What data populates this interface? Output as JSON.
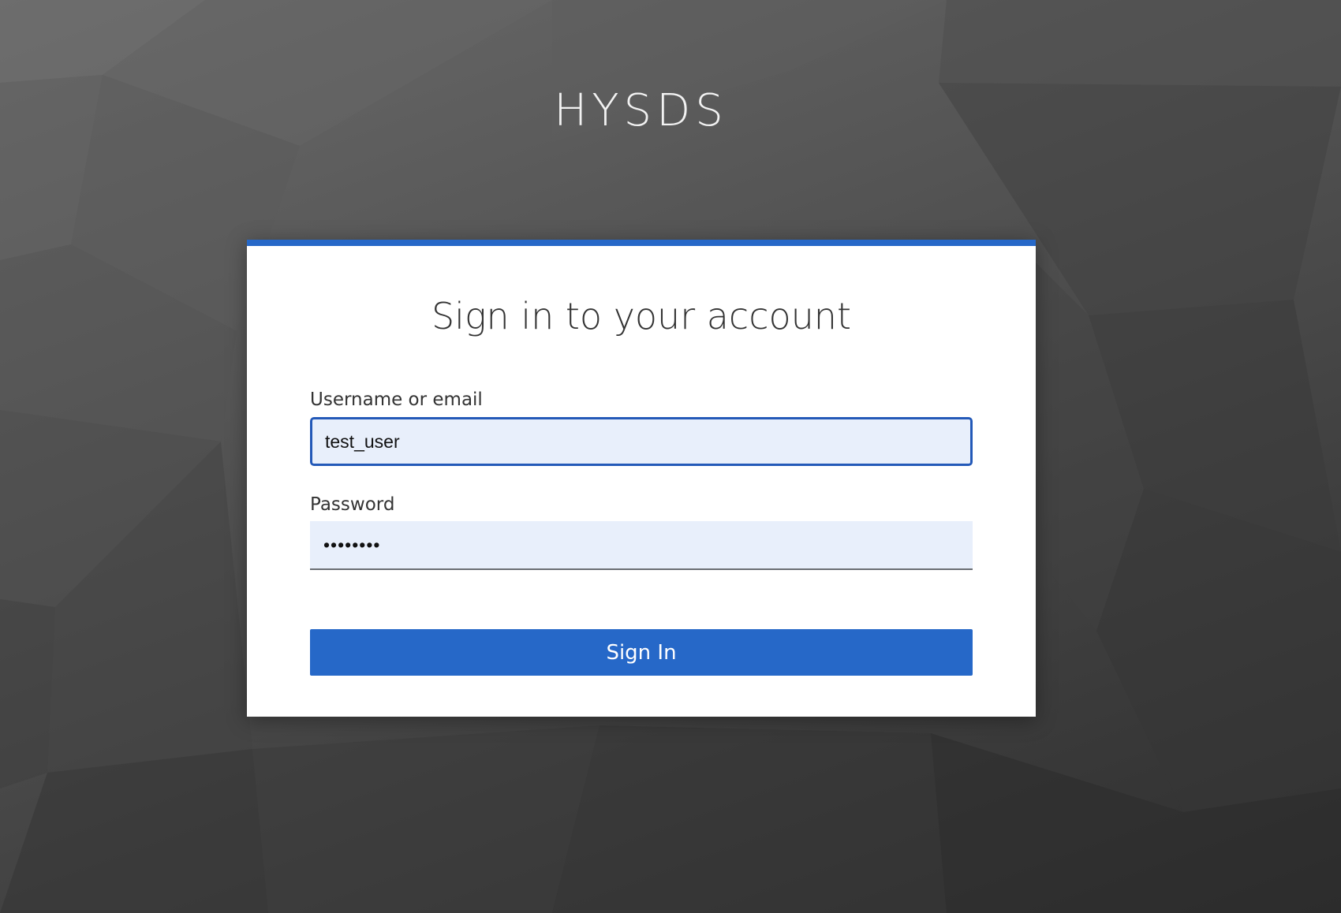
{
  "app": {
    "title": "HYSDS"
  },
  "login": {
    "heading": "Sign in to your account",
    "username_label": "Username or email",
    "username_value": "test_user",
    "password_label": "Password",
    "password_value": "••••••••",
    "submit_label": "Sign In"
  },
  "colors": {
    "accent": "#2668c8",
    "input_background": "#e8effb",
    "focus_border": "#2359b8",
    "background_light": "#6a6a6a",
    "background_dark": "#2e2e2e"
  }
}
